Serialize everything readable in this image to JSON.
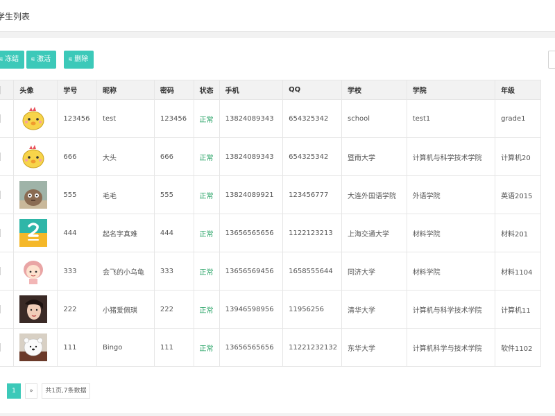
{
  "header": {
    "title": "学生列表"
  },
  "toolbar": {
    "freeze_label": "冻结",
    "activate_label": "激活",
    "delete_label": "删除",
    "icon": "sliders-icon"
  },
  "table": {
    "columns": [
      "头像",
      "学号",
      "昵称",
      "密码",
      "状态",
      "手机",
      "QQ",
      "学校",
      "学院",
      "年级"
    ],
    "rows": [
      {
        "avatar": "chick-avatar",
        "id": "123456",
        "nickname": "test",
        "password": "123456",
        "status": "正常",
        "phone": "13824089343",
        "qq": "654325342",
        "school": "school",
        "college": "test1",
        "grade": "grade1"
      },
      {
        "avatar": "chick-avatar",
        "id": "666",
        "nickname": "大头",
        "password": "666",
        "status": "正常",
        "phone": "13824089343",
        "qq": "654325342",
        "school": "暨南大学",
        "college": "计算机与科学技术学院",
        "grade": "计算机20"
      },
      {
        "avatar": "cartoon-avatar",
        "id": "555",
        "nickname": "毛毛",
        "password": "555",
        "status": "正常",
        "phone": "13824089921",
        "qq": "123456777",
        "school": "大连外国语学院",
        "college": "外语学院",
        "grade": "英语2015"
      },
      {
        "avatar": "number-avatar",
        "id": "444",
        "nickname": "起名字真难",
        "password": "444",
        "status": "正常",
        "phone": "13656565656",
        "qq": "1122123213",
        "school": "上海交通大学",
        "college": "材料学院",
        "grade": "材料201"
      },
      {
        "avatar": "girl-avatar",
        "id": "333",
        "nickname": "会飞的小乌龟",
        "password": "333",
        "status": "正常",
        "phone": "13656569456",
        "qq": "1658555644",
        "school": "同济大学",
        "college": "材料学院",
        "grade": "材料1104"
      },
      {
        "avatar": "photo-avatar",
        "id": "222",
        "nickname": "小猪爱佩琪",
        "password": "222",
        "status": "正常",
        "phone": "13946598956",
        "qq": "11956256",
        "school": "清华大学",
        "college": "计算机与科学技术学院",
        "grade": "计算机11"
      },
      {
        "avatar": "bear-avatar",
        "id": "111",
        "nickname": "Bingo",
        "password": "111",
        "status": "正常",
        "phone": "13656565656",
        "qq": "11221232132",
        "school": "东华大学",
        "college": "计算机科学与技术学院",
        "grade": "软件1102"
      }
    ]
  },
  "pagination": {
    "current": "1",
    "next": "»",
    "summary": "共1页,7条数据"
  },
  "colors": {
    "accent": "#3cc9b9",
    "status_ok": "#20a060"
  }
}
